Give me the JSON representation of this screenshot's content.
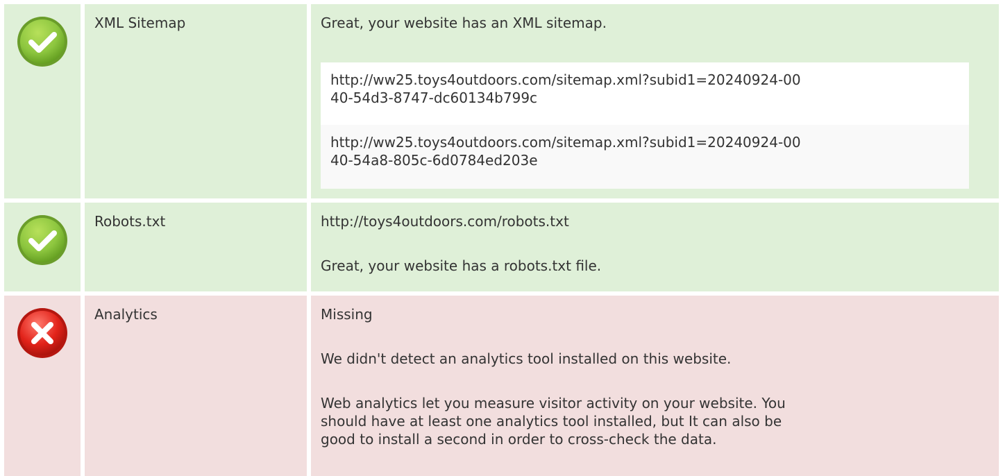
{
  "rows": [
    {
      "status": "pass",
      "icon": "check-circle-icon",
      "label": "XML Sitemap",
      "intro": "Great, your website has an XML sitemap.",
      "urls": [
        {
          "line1": "http://ww25.toys4outdoors.com/sitemap.xml?subid1=20240924-00",
          "line2": "40-54d3-8747-dc60134b799c"
        },
        {
          "line1": "http://ww25.toys4outdoors.com/sitemap.xml?subid1=20240924-00",
          "line2": "40-54a8-805c-6d0784ed203e"
        }
      ]
    },
    {
      "status": "pass",
      "icon": "check-circle-icon",
      "label": "Robots.txt",
      "url": "http://toys4outdoors.com/robots.txt",
      "message": "Great, your website has a robots.txt file."
    },
    {
      "status": "fail",
      "icon": "x-circle-icon",
      "label": "Analytics",
      "status_text": "Missing",
      "message": "We didn't detect an analytics tool installed on this website.",
      "advice_lines": [
        "Web analytics let you measure visitor activity on your website. You",
        "should have at least one analytics tool installed, but It can also be",
        "good to install a second in order to cross-check the data."
      ]
    }
  ],
  "colors": {
    "pass_bg": "#dff0d8",
    "fail_bg": "#f2dede",
    "pass_icon": "#8dc63f",
    "fail_icon": "#e2231a",
    "text": "#333333"
  }
}
